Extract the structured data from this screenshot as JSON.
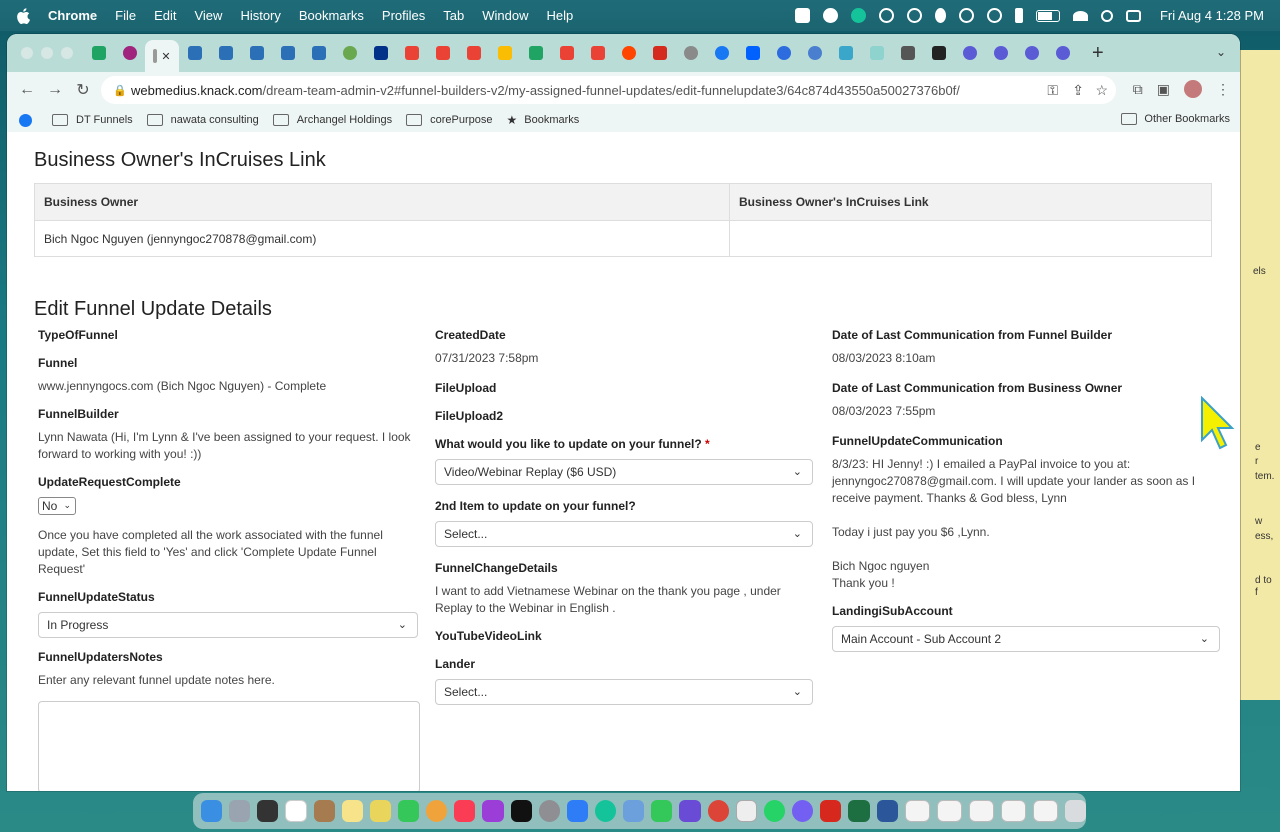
{
  "menubar": {
    "app_name": "Chrome",
    "items": [
      "File",
      "Edit",
      "View",
      "History",
      "Bookmarks",
      "Profiles",
      "Tab",
      "Window",
      "Help"
    ],
    "clock": "Fri Aug 4  1:28 PM"
  },
  "toolbar": {
    "url_domain": "webmedius.knack.com",
    "url_path": "/dream-team-admin-v2#funnel-builders-v2/my-assigned-funnel-updates/edit-funnelupdate3/64c874d43550a50027376b0f/"
  },
  "bookmarks": {
    "items": [
      "DT Funnels",
      "nawata consulting",
      "Archangel Holdings",
      "corePurpose",
      "Bookmarks"
    ],
    "other": "Other Bookmarks"
  },
  "side_strip": {
    "texts": [
      "els",
      "e",
      "r",
      "tem.",
      "w",
      "ess,",
      "d to",
      "f"
    ]
  },
  "incruises": {
    "title": "Business Owner's InCruises Link",
    "columns": [
      "Business Owner",
      "Business Owner's InCruises Link"
    ],
    "rows": [
      [
        "Bich Ngoc Nguyen (jennyngoc270878@gmail.com)",
        ""
      ]
    ]
  },
  "edit": {
    "title": "Edit Funnel Update Details",
    "col1": {
      "type_label": "TypeOfFunnel",
      "funnel_label": "Funnel",
      "funnel_value": "www.jennyngocs.com (Bich Ngoc Nguyen) - Complete",
      "builder_label": "FunnelBuilder",
      "builder_value": "Lynn Nawata (Hi, I'm Lynn & I've been assigned to your request. I look forward to working with you! :))",
      "complete_label": "UpdateRequestComplete",
      "complete_value": "No",
      "complete_help": "Once you have completed all the work associated with the funnel update, Set this field to 'Yes' and click 'Complete Update Funnel Request'",
      "status_label": "FunnelUpdateStatus",
      "status_value": "In Progress",
      "notes_label": "FunnelUpdatersNotes",
      "notes_help": "Enter any relevant funnel update notes here."
    },
    "col2": {
      "created_label": "CreatedDate",
      "created_value": "07/31/2023 7:58pm",
      "file_label": "FileUpload",
      "file2_label": "FileUpload2",
      "update_label": "What would you like to update on your funnel?",
      "update_required": "*",
      "update_value": "Video/Webinar Replay ($6 USD)",
      "second_label": "2nd Item to update on your funnel?",
      "second_value": "Select...",
      "change_label": "FunnelChangeDetails",
      "change_value": "I want to add Vietnamese Webinar on the thank you page , under Replay to the Webinar in English .",
      "youtube_label": "YouTubeVideoLink",
      "lander_label": "Lander",
      "lander_value": "Select..."
    },
    "col3": {
      "last_builder_label": "Date of Last Communication from Funnel Builder",
      "last_builder_value": "08/03/2023 8:10am",
      "last_owner_label": "Date of Last Communication from Business Owner",
      "last_owner_value": "08/03/2023 7:55pm",
      "comm_label": "FunnelUpdateCommunication",
      "comm_p1": "8/3/23: HI Jenny! :) I emailed a PayPal invoice to you at: jennyngoc270878@gmail.com. I will update your lander as soon as I receive payment. Thanks & God bless, Lynn",
      "comm_p2": "Today i just pay you $6 ,Lynn.",
      "comm_p3a": "Bich Ngoc nguyen",
      "comm_p3b": "Thank you !",
      "sub_label": "LandingiSubAccount",
      "sub_value": "Main Account - Sub Account 2"
    }
  },
  "colors": {
    "accent_red": "#cc0000",
    "tab_bar": "#b9dcd7",
    "toolbar": "#eef6f5"
  }
}
